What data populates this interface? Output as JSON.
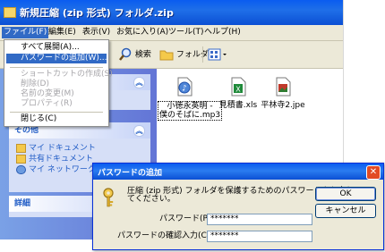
{
  "window": {
    "title": "新規圧縮 (zip 形式) フォルダ.zip"
  },
  "menubar": {
    "items": [
      "ファイル(F)",
      "編集(E)",
      "表示(V)",
      "お気に入り(A)",
      "ツール(T)",
      "ヘルプ(H)"
    ]
  },
  "toolbar": {
    "search": "検索",
    "folder": "フォルダ"
  },
  "filemenu": {
    "expand_all": "すべて展開(A)...",
    "add_password": "パスワードの追加(W)...",
    "create_shortcut": "ショートカットの作成(S)",
    "delete": "削除(D)",
    "rename": "名前の変更(M)",
    "properties": "プロパティ(R)",
    "close": "閉じる(C)"
  },
  "leftpane": {
    "other_header": "その他",
    "links": [
      "マイ ドキュメント",
      "共有ドキュメント",
      "マイ ネットワーク"
    ],
    "details_header": "詳細"
  },
  "files": [
    {
      "name_line1": "小徳永英明 -",
      "name_line2": "僕のそばに.mp3"
    },
    {
      "name_line1": "見積書.xls",
      "name_line2": ""
    },
    {
      "name_line1": "平林寺2.jpe",
      "name_line2": ""
    }
  ],
  "dialog": {
    "title": "パスワードの追加",
    "message_line1": "圧縮 (zip 形式) フォルダを保護するためのパスワードを入力し",
    "message_line2": "てください。",
    "password_label": "パスワード(P):",
    "password_value": "*******",
    "confirm_label": "パスワードの確認入力(C):",
    "confirm_value": "*******",
    "ok": "OK",
    "cancel": "キャンセル"
  },
  "colors": {
    "titlebar": "#0a5cf0",
    "menu_highlight": "#316ac5",
    "panel_link": "#215dc6"
  }
}
